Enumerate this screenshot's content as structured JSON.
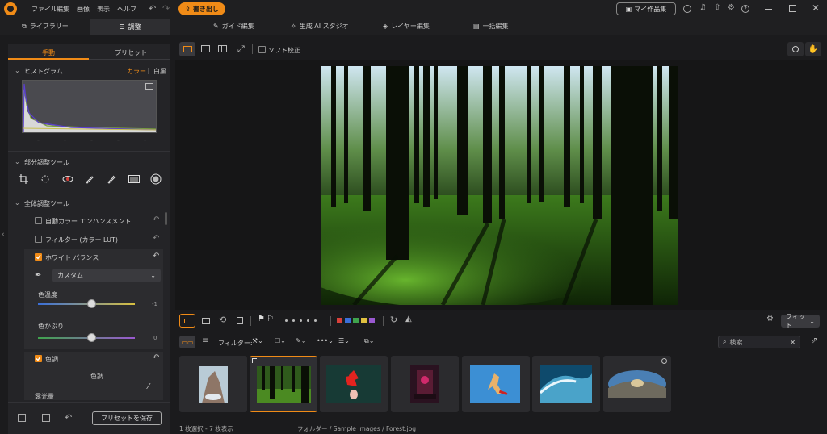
{
  "menu": {
    "file": "ファイル",
    "edit": "編集",
    "image": "画像",
    "view": "表示",
    "help": "ヘルプ",
    "export": "書き出し",
    "my_works": "マイ作品集"
  },
  "tabs": {
    "library": "ライブラリー",
    "adjust": "調整",
    "guide": "ガイド編集",
    "ai": "生成 AI スタジオ",
    "layer": "レイヤー編集",
    "batch": "一括編集"
  },
  "panel": {
    "tab_manual": "手動",
    "tab_preset": "プリセット",
    "histogram": "ヒストグラム",
    "color": "カラー",
    "bw": "白黒",
    "local_tools": "部分調整ツール",
    "global_tools": "全体調整ツール",
    "auto_color": "自動カラー エンハンスメント",
    "filter": "フィルター (カラー LUT)",
    "wb": "ホワイト バランス",
    "wb_mode": "カスタム",
    "temp": "色温度",
    "temp_val": "-1",
    "tint": "色かぶり",
    "tint_val": "0",
    "tone": "色調",
    "tone_center": "色調",
    "semi": "露光量",
    "save_preset": "プリセットを保存"
  },
  "viewer": {
    "soft": "ソフト校正"
  },
  "strip": {
    "filter": "フィルター:",
    "fit": "フィット",
    "search": "検索"
  },
  "status": {
    "selected": "1 枚選択 - 7 枚表示",
    "path": "フォルダー / Sample Images / Forest.jpg"
  },
  "colors": {
    "accent": "#f08b17",
    "bg": "#1b1b1d",
    "panel": "#242427",
    "label_red": "#d9403a",
    "label_blue": "#3a6fd9",
    "label_green": "#3fa34d",
    "label_yellow": "#e0c040",
    "label_purple": "#9a59d1"
  }
}
